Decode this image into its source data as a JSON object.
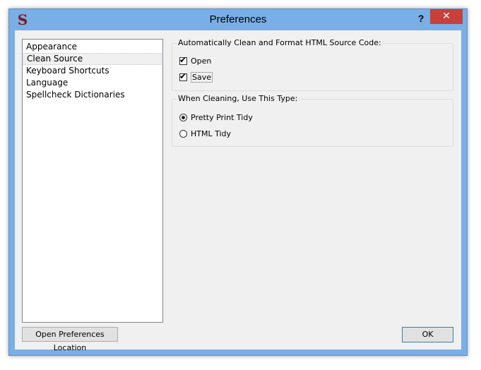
{
  "window": {
    "title": "Preferences",
    "app_icon_glyph": "S",
    "help_label": "?",
    "close_label": "✕"
  },
  "sidebar": {
    "items": [
      {
        "label": "Appearance",
        "selected": false
      },
      {
        "label": "Clean Source",
        "selected": true
      },
      {
        "label": "Keyboard Shortcuts",
        "selected": false
      },
      {
        "label": "Language",
        "selected": false
      },
      {
        "label": "Spellcheck Dictionaries",
        "selected": false
      }
    ]
  },
  "auto_clean_group": {
    "legend": "Automatically Clean and Format HTML Source Code:",
    "options": [
      {
        "label": "Open",
        "checked": true
      },
      {
        "label": "Save",
        "checked": true
      }
    ]
  },
  "cleaning_type_group": {
    "legend": "When Cleaning, Use This Type:",
    "options": [
      {
        "label": "Pretty Print Tidy",
        "selected": true
      },
      {
        "label": "HTML Tidy",
        "selected": false
      }
    ]
  },
  "footer": {
    "open_location_label": "Open Preferences Location",
    "ok_label": "OK"
  },
  "colors": {
    "window_frame": "#7aaee6",
    "close_button": "#c7413a",
    "dialog_background": "#f0f0f0"
  }
}
